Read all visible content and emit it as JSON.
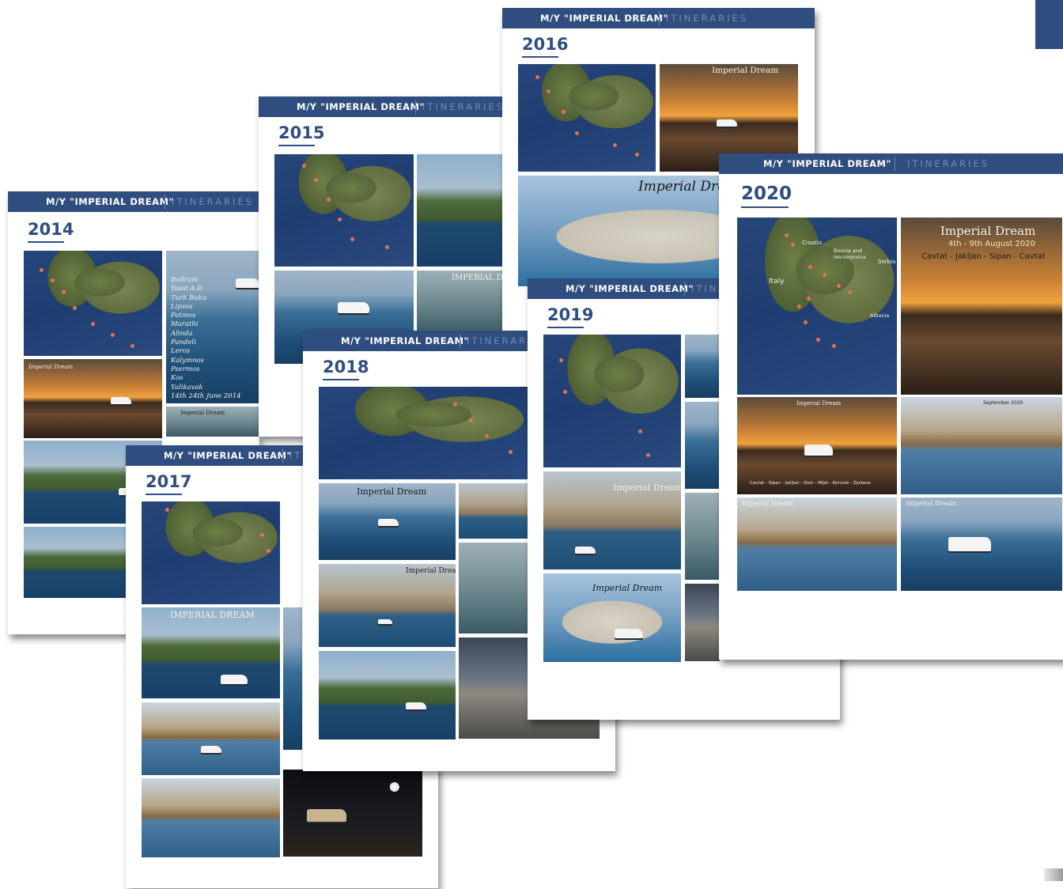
{
  "header": {
    "yacht_label": "M/Y \"IMPERIAL DREAM\"",
    "section_label": "ITINERARIES"
  },
  "pages": {
    "p2014": {
      "year": "2014"
    },
    "p2015": {
      "year": "2015"
    },
    "p2016": {
      "year": "2016"
    },
    "p2017": {
      "year": "2017"
    },
    "p2018": {
      "year": "2018"
    },
    "p2019": {
      "year": "2019"
    },
    "p2020": {
      "year": "2020",
      "title_script": "Imperial Dream",
      "dates": "4th - 9th August 2020",
      "route": "Cavtat - Jakljan - Sipan - Cavtat",
      "map_labels": {
        "croatia": "Croatia",
        "bosnia": "Bosnia and Herzegovina",
        "serbia": "Serbia",
        "italy": "Italy",
        "albania": "Albania"
      },
      "photo2_title": "Imperial Dream",
      "photo2_route": "Cavtat - Sipan - Jakljan - Ston - Mljet - Korcula - Zjuliana",
      "photo3_date": "September 2020",
      "photo4_title": "Imperial Dream"
    }
  },
  "captions": {
    "p2014_list": [
      "Bodrum",
      "Yassi A.D",
      "Turk Buku",
      "Lipsos",
      "Patmos",
      "Marathi",
      "Alinda",
      "Pandeli",
      "Leros",
      "Kalymnos",
      "Psermos",
      "Kos",
      "Yalikavak",
      "14th 24th June 2014"
    ],
    "p2014_sunset": "Imperial Dream",
    "p2014_bottom": "Imperial Dream",
    "p2015_title": "IMPERIAL D",
    "p2016_title": "Imperial Dream",
    "p2016_title2": "Imperial Dream",
    "p2017_title": "IMPERIAL DREAM",
    "p2018_title": "Imperial Dream",
    "p2018_title2": "Imperial Dream",
    "p2019_title": "Imperial Dream",
    "p2019_title2": "Imperial Dream"
  },
  "colors": {
    "brand_navy": "#2f4d7e",
    "accent_light": "#6f8ab8",
    "marker": "#e5734f"
  }
}
